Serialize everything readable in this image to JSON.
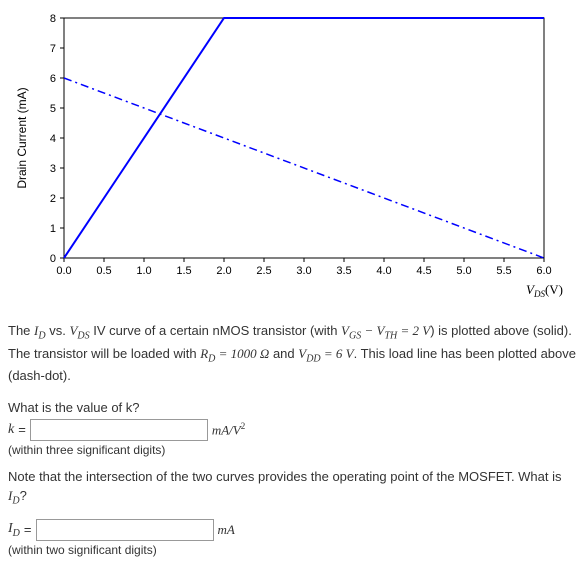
{
  "chart_data": {
    "type": "line",
    "title": "",
    "xlabel": "V_DS (V)",
    "ylabel": "Drain Current (mA)",
    "xlim": [
      0,
      6
    ],
    "ylim": [
      0,
      8
    ],
    "xticks": [
      0.0,
      0.5,
      1.0,
      1.5,
      2.0,
      2.5,
      3.0,
      3.5,
      4.0,
      4.5,
      5.0,
      5.5,
      6.0
    ],
    "yticks": [
      0,
      1,
      2,
      3,
      4,
      5,
      6,
      7,
      8
    ],
    "series": [
      {
        "name": "IV curve (solid)",
        "style": "solid",
        "color": "#0000ff",
        "points": [
          {
            "x": 0.0,
            "y": 0.0
          },
          {
            "x": 2.0,
            "y": 8.0
          },
          {
            "x": 6.0,
            "y": 8.0
          }
        ]
      },
      {
        "name": "Load line (dash-dot)",
        "style": "dash-dot",
        "color": "#0000ff",
        "points": [
          {
            "x": 0.0,
            "y": 6.0
          },
          {
            "x": 6.0,
            "y": 0.0
          }
        ]
      }
    ]
  },
  "description": {
    "line1_prefix": "The ",
    "line1_iv": "I_D vs. V_DS",
    "line1_mid": " IV curve of a certain nMOS transistor (with ",
    "line1_cond": "V_GS − V_TH = 2 V",
    "line1_suffix": ") is plotted above (solid). The transistor will be loaded with ",
    "line1_rd": "R_D = 1000 Ω",
    "line1_and": " and ",
    "line1_vdd": "V_DD = 6 V",
    "line1_end": ". This load line has been plotted above (dash-dot)."
  },
  "q1": {
    "prompt": "What is the value of k?",
    "var": "k",
    "eq": " =",
    "unit": "mA/V²",
    "hint": "(within three significant digits)"
  },
  "note": "Note that the intersection of the two curves provides the operating point of the MOSFET. What is I_D?",
  "q2": {
    "var": "I_D",
    "eq": " =",
    "unit": "mA",
    "hint": "(within two significant digits)"
  },
  "inputs": {
    "k_value": "",
    "id_value": ""
  }
}
